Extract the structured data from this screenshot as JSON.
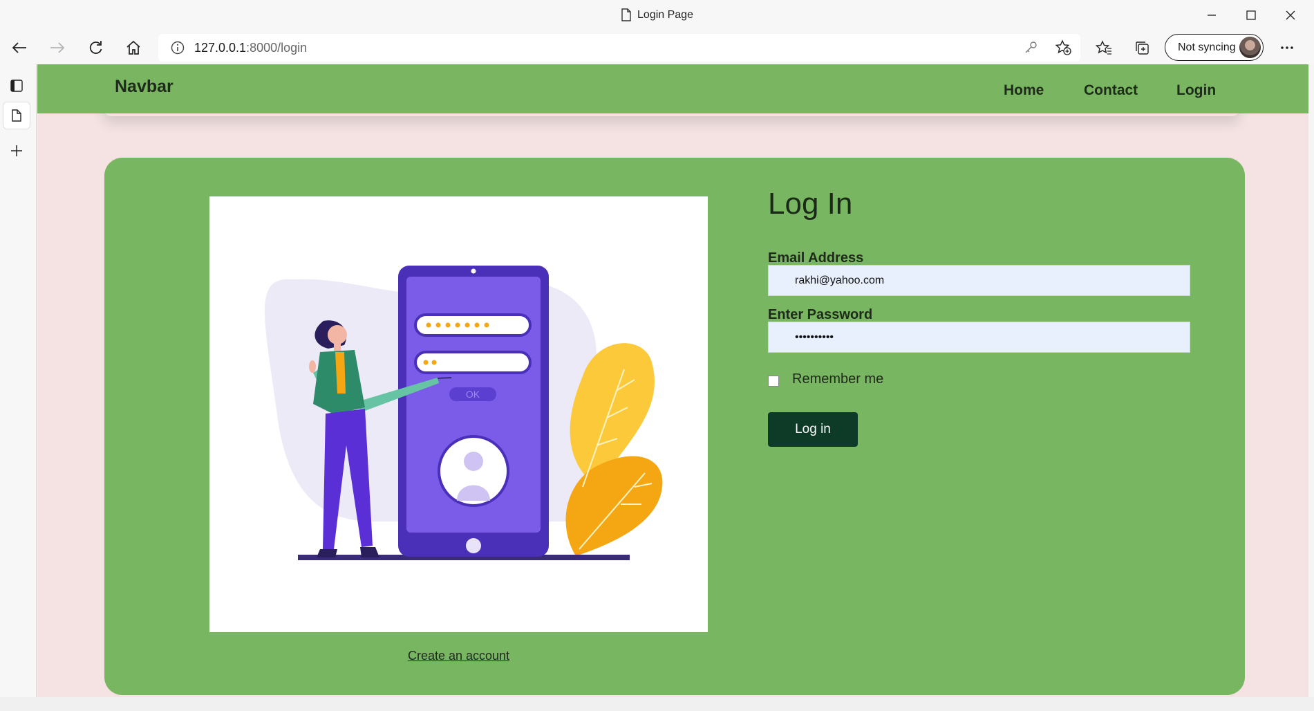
{
  "window": {
    "title": "Login Page"
  },
  "browser": {
    "url_host": "127.0.0.1",
    "url_path": ":8000/login",
    "profile_label": "Not syncing"
  },
  "navbar": {
    "brand": "Navbar",
    "links": [
      "Home",
      "Contact",
      "Login"
    ]
  },
  "login": {
    "heading": "Log In",
    "email_label": "Email Address",
    "email_value": "rakhi@yahoo.com",
    "password_label": "Enter Password",
    "password_value": "••••••••••",
    "remember_label": "Remember me",
    "submit_label": "Log in",
    "create_account_label": "Create an account",
    "illustration_ok_label": "OK"
  },
  "colors": {
    "navbar_bg": "#7ab662",
    "card_bg": "#79b661",
    "page_bg": "#f4e3e2",
    "button_bg": "#0e3a28",
    "phone_purple": "#6c4ed8"
  },
  "icons": [
    "page-icon",
    "minimize-icon",
    "maximize-icon",
    "close-icon",
    "back-icon",
    "forward-icon",
    "refresh-icon",
    "home-icon",
    "info-icon",
    "key-icon",
    "add-favorite-icon",
    "favorites-icon",
    "collections-icon",
    "more-icon",
    "tab-actions-icon",
    "current-tab-icon",
    "new-tab-icon"
  ]
}
